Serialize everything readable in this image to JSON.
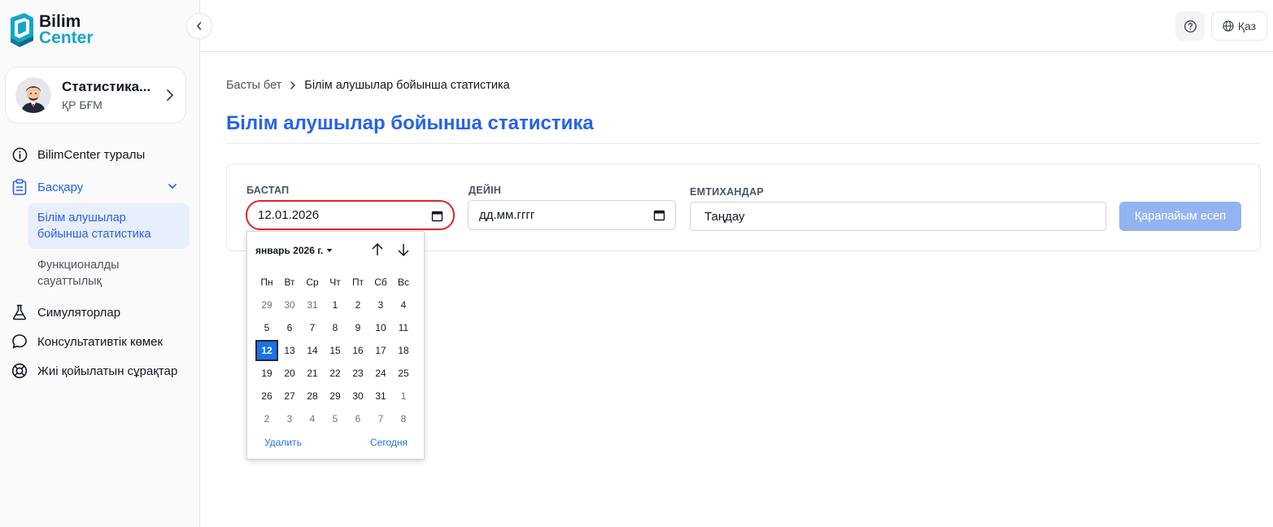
{
  "brand": {
    "line1": "Bilim",
    "line2": "Center"
  },
  "profile": {
    "name": "Статистика...",
    "org": "ҚР БҒМ"
  },
  "sidebar": {
    "items": [
      {
        "label": "BilimCenter туралы"
      },
      {
        "label": "Басқару",
        "children": [
          {
            "label": "Білім алушылар бойынша статистика"
          },
          {
            "label": "Функционалды сауаттылық"
          }
        ]
      },
      {
        "label": "Симуляторлар"
      },
      {
        "label": "Консультативтік көмек"
      },
      {
        "label": "Жиі қойылатын сұрақтар"
      }
    ]
  },
  "topbar": {
    "language": "Қаз"
  },
  "breadcrumb": {
    "home": "Басты бет",
    "current": "Білім алушылар бойынша статистика"
  },
  "page": {
    "title": "Білім алушылар бойынша статистика"
  },
  "filters": {
    "from_label": "БАСТАП",
    "from_value": "12.01.2026",
    "to_label": "ДЕЙІН",
    "to_value": "дд.мм.гггг",
    "exams_label": "ЕМТИХАНДАР",
    "exams_value": "Таңдау",
    "report_button": "Қарапайым есеп"
  },
  "datepicker": {
    "month_label": "январь 2026 г.",
    "weekdays": [
      "Пн",
      "Вт",
      "Ср",
      "Чт",
      "Пт",
      "Сб",
      "Вс"
    ],
    "weeks": [
      [
        "29",
        "30",
        "31",
        "1",
        "2",
        "3",
        "4"
      ],
      [
        "5",
        "6",
        "7",
        "8",
        "9",
        "10",
        "11"
      ],
      [
        "12",
        "13",
        "14",
        "15",
        "16",
        "17",
        "18"
      ],
      [
        "19",
        "20",
        "21",
        "22",
        "23",
        "24",
        "25"
      ],
      [
        "26",
        "27",
        "28",
        "29",
        "30",
        "31",
        "1"
      ],
      [
        "2",
        "3",
        "4",
        "5",
        "6",
        "7",
        "8"
      ]
    ],
    "selected_day": "12",
    "clear_label": "Удалить",
    "today_label": "Сегодня"
  },
  "colors": {
    "accent": "#2563eb",
    "brand_teal": "#14a6c9",
    "focus_ring": "#dc2626",
    "button_disabled": "#93b4f0"
  }
}
